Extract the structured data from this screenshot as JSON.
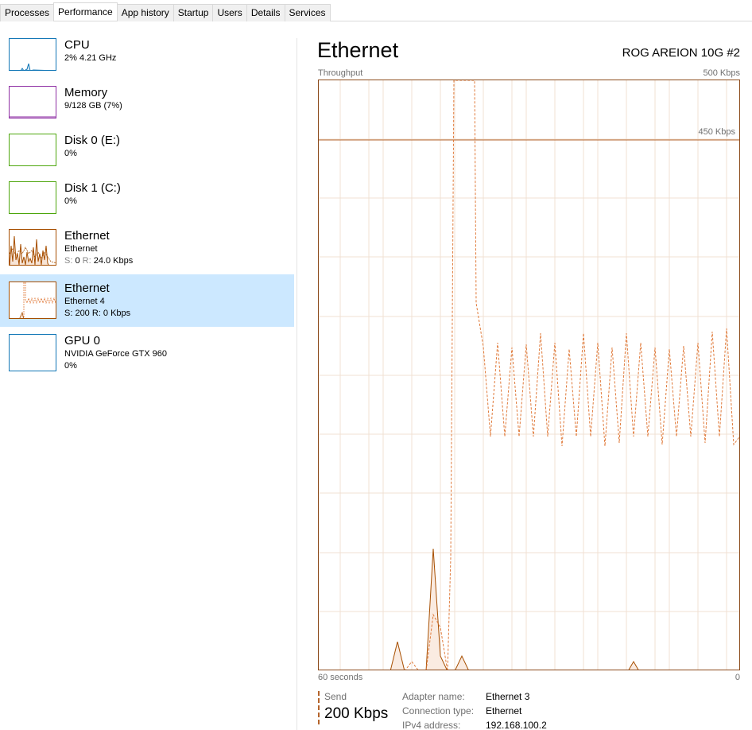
{
  "tabs": [
    {
      "label": "Processes",
      "active": false
    },
    {
      "label": "Performance",
      "active": true
    },
    {
      "label": "App history",
      "active": false
    },
    {
      "label": "Startup",
      "active": false
    },
    {
      "label": "Users",
      "active": false
    },
    {
      "label": "Details",
      "active": false
    },
    {
      "label": "Services",
      "active": false
    }
  ],
  "sidebar": {
    "items": [
      {
        "title": "CPU",
        "line1": "2% 4.21 GHz",
        "color": "#1176b6"
      },
      {
        "title": "Memory",
        "line1": "9/128 GB (7%)",
        "color": "#8e2ea3"
      },
      {
        "title": "Disk 0 (E:)",
        "line1": "0%",
        "color": "#4da60c"
      },
      {
        "title": "Disk 1 (C:)",
        "line1": "0%",
        "color": "#4da60c"
      },
      {
        "title": "Ethernet",
        "line1": "Ethernet",
        "send_label": "S:",
        "send_value": "0",
        "recv_label": "R:",
        "recv_value": "24.0 Kbps",
        "color": "#a74f01"
      },
      {
        "title": "Ethernet",
        "line1": "Ethernet 4",
        "line2": "S: 200 R: 0 Kbps",
        "color": "#a74f01",
        "selected": true
      },
      {
        "title": "GPU 0",
        "line1": "NVIDIA GeForce GTX 960",
        "line2": "0%",
        "color": "#1176b6"
      }
    ]
  },
  "main": {
    "title": "Ethernet",
    "adapter_title": "ROG AREION 10G #2",
    "graph": {
      "y_label": "Throughput",
      "y_max": "500 Kbps",
      "scale_line": "450 Kbps",
      "x_left": "60 seconds",
      "x_right": "0"
    },
    "send": {
      "label": "Send",
      "value": "200 Kbps"
    },
    "properties": [
      {
        "name": "Adapter name:",
        "value": "Ethernet 3"
      },
      {
        "name": "Connection type:",
        "value": "Ethernet"
      },
      {
        "name": "IPv4 address:",
        "value": "192.168.100.2"
      }
    ]
  },
  "colors": {
    "accent": "#a74f01",
    "selected_bg": "#cce8ff",
    "receive_line": "#e07a3a",
    "send_line": "#a74f01",
    "grid": "#f1e1d3"
  }
}
